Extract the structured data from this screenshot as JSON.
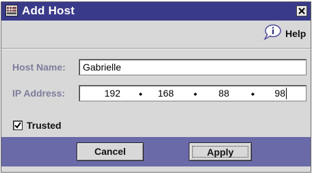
{
  "window": {
    "title": "Add Host",
    "icon": "network-grid-icon",
    "close_icon": "close-icon"
  },
  "help": {
    "label": "Help",
    "icon": "help-balloon-icon"
  },
  "form": {
    "host_name": {
      "label": "Host Name:",
      "value": "Gabrielle"
    },
    "ip_address": {
      "label": "IP Address:",
      "octets": [
        "192",
        "168",
        "88",
        "98"
      ]
    },
    "trusted": {
      "label": "Trusted",
      "checked": true
    }
  },
  "buttons": {
    "cancel": "Cancel",
    "apply": "Apply"
  },
  "colors": {
    "titlebar": "#3a3a8a",
    "button_bar": "#6a6aa8",
    "label_text": "#7d7d9c",
    "dialog_bg": "#d8d8d8"
  }
}
